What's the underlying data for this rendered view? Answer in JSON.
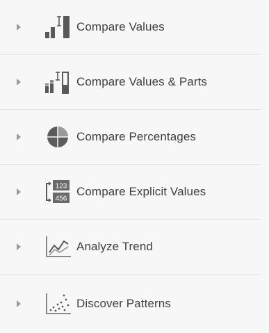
{
  "menu": {
    "items": [
      {
        "label": "Compare Values",
        "icon": "compare-values-icon"
      },
      {
        "label": "Compare Values & Parts",
        "icon": "compare-values-parts-icon"
      },
      {
        "label": "Compare Percentages",
        "icon": "pie-chart-icon"
      },
      {
        "label": "Compare Explicit Values",
        "icon": "explicit-values-icon",
        "icon_text_top": "123",
        "icon_text_bottom": "456"
      },
      {
        "label": "Analyze Trend",
        "icon": "line-chart-icon"
      },
      {
        "label": "Discover Patterns",
        "icon": "scatter-plot-icon"
      }
    ]
  },
  "colors": {
    "background": "#f7f7f7",
    "text": "#3f3f3f",
    "icon": "#595959",
    "chevron": "#9a9a9a",
    "divider": "#e6e6e6"
  }
}
